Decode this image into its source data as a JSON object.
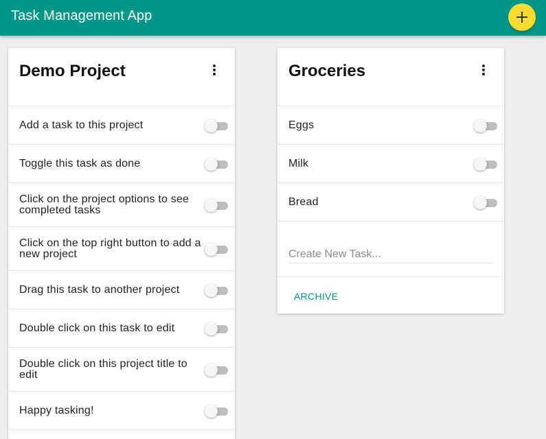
{
  "app": {
    "title": "Task Management App",
    "accent_color": "#009688",
    "fab_color": "#fbdc2e",
    "add_icon": "plus-icon"
  },
  "projects": [
    {
      "title": "Demo Project",
      "menu_icon": "more-vertical-icon",
      "tasks": [
        {
          "label": "Add a task to this project",
          "done": false
        },
        {
          "label": "Toggle this task as done",
          "done": false
        },
        {
          "label": "Click on the project options to see completed tasks",
          "done": false
        },
        {
          "label": "Click on the top right button to add a new project",
          "done": false
        },
        {
          "label": "Drag this task to another project",
          "done": false
        },
        {
          "label": "Double click on this task to edit",
          "done": false
        },
        {
          "label": "Double click on this project title to edit",
          "done": false
        },
        {
          "label": "Happy tasking!",
          "done": false
        }
      ]
    },
    {
      "title": "Groceries",
      "menu_icon": "more-vertical-icon",
      "tasks": [
        {
          "label": "Eggs",
          "done": false
        },
        {
          "label": "Milk",
          "done": false
        },
        {
          "label": "Bread",
          "done": false
        }
      ],
      "new_task_placeholder": "Create New Task...",
      "new_task_value": "",
      "archive_label": "ARCHIVE"
    }
  ]
}
